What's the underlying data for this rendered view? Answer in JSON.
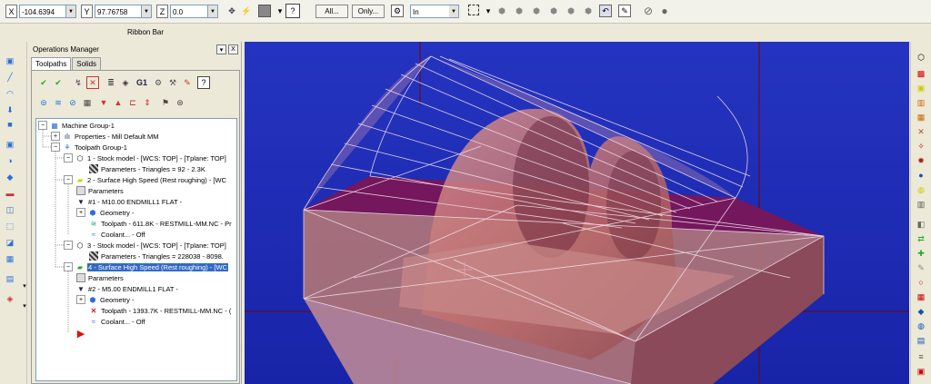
{
  "coords": {
    "x_label": "X",
    "x_value": "-104.6394",
    "y_label": "Y",
    "y_value": "97.76758",
    "z_label": "Z",
    "z_value": "0.0"
  },
  "toolbar": {
    "all_label": "All...",
    "only_label": "Only...",
    "selection_mode": "In"
  },
  "ribbon": {
    "label": "Ribbon Bar"
  },
  "ops": {
    "title": "Operations Manager",
    "pin": "▾",
    "close": "X",
    "tabs": [
      "Toolpaths",
      "Solids"
    ],
    "tree": [
      {
        "text": "Machine Group-1",
        "icon": "machine-group-icon"
      },
      {
        "text": "Properties - Mill Default MM",
        "icon": "properties-icon"
      },
      {
        "text": "Toolpath Group-1",
        "icon": "toolpath-group-icon"
      },
      {
        "text": "1 - Stock model - [WCS: TOP] - [Tplane: TOP]",
        "icon": "stock-model-icon"
      },
      {
        "text": "Parameters - Triangles = 92 - 2.3K",
        "icon": "parameters-icon"
      },
      {
        "text": "2 - Surface High Speed (Rest roughing) - [WC",
        "icon": "folder-icon"
      },
      {
        "text": "Parameters",
        "icon": "parameters-icon"
      },
      {
        "text": "#1 - M10.00 ENDMILL1 FLAT -",
        "icon": "tool-icon"
      },
      {
        "text": "Geometry -",
        "icon": "geometry-icon"
      },
      {
        "text": "Toolpath - 611.8K - RESTMILL-MM.NC - Pr",
        "icon": "toolpath-icon"
      },
      {
        "text": "Coolant... - Off",
        "icon": "coolant-icon"
      },
      {
        "text": "3 - Stock model - [WCS: TOP] - [Tplane: TOP]",
        "icon": "stock-model-icon"
      },
      {
        "text": "Parameters - Triangles = 228038 - 8098.",
        "icon": "parameters-icon"
      },
      {
        "text": "4 - Surface High Speed (Rest roughing) - [WC",
        "icon": "folder-icon"
      },
      {
        "text": "Parameters",
        "icon": "parameters-icon"
      },
      {
        "text": "#2 - M5.00 ENDMILL1 FLAT -",
        "icon": "tool-icon"
      },
      {
        "text": "Geometry -",
        "icon": "geometry-icon"
      },
      {
        "text": "Toolpath - 1393.7K - RESTMILL-MM.NC - (",
        "icon": "toolpath-dirty-icon"
      },
      {
        "text": "Coolant... - Off",
        "icon": "coolant-icon"
      }
    ]
  },
  "colors": {
    "viewport": "#1e2cb8",
    "selection": "#316ac5",
    "model": "#c77c7c"
  }
}
